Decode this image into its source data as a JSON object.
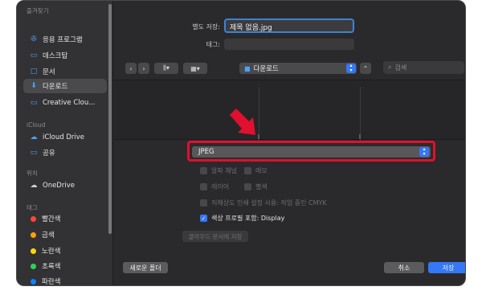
{
  "sidebar": {
    "favorites_header": "즐겨찾기",
    "favorites": [
      {
        "label": "응용 프로그램",
        "icon": "applications-icon"
      },
      {
        "label": "데스크탑",
        "icon": "desktop-icon"
      },
      {
        "label": "문서",
        "icon": "document-icon"
      },
      {
        "label": "다운로드",
        "icon": "download-icon",
        "active": true
      },
      {
        "label": "Creative Clou...",
        "icon": "folder-icon"
      }
    ],
    "icloud_header": "iCloud",
    "icloud": [
      {
        "label": "iCloud Drive",
        "icon": "cloud-icon"
      },
      {
        "label": "공유",
        "icon": "shared-folder-icon"
      }
    ],
    "locations_header": "위치",
    "locations": [
      {
        "label": "OneDrive",
        "icon": "cloud-icon"
      }
    ],
    "tags_header": "태그",
    "tags": [
      {
        "label": "빨간색",
        "color": "#ff453a"
      },
      {
        "label": "금색",
        "color": "#ff9f0a"
      },
      {
        "label": "노란색",
        "color": "#ffd60a"
      },
      {
        "label": "초록색",
        "color": "#30d158"
      },
      {
        "label": "파란색",
        "color": "#0a84ff"
      }
    ]
  },
  "form": {
    "save_as_label": "별도 저장:",
    "filename": "제목 없음.jpg",
    "tags_label": "태그:"
  },
  "toolbar": {
    "location": "다운로드",
    "search_placeholder": "검색"
  },
  "format": {
    "selected": "JPEG"
  },
  "options": {
    "alpha": "알파 채널",
    "memo": "메모",
    "layer": "레이어",
    "spot": "별색",
    "low_res": "저해상도 인쇄 설정 사용: 작업 중인 CMYK",
    "color_profile": "색상 프로필 포함: Display",
    "save_cloud": "클라우드 문서에 저장"
  },
  "buttons": {
    "new_folder": "새로운 폴더",
    "cancel": "취소",
    "save": "저장"
  },
  "colors": {
    "accent": "#3478f6",
    "highlight": "#e0102e"
  }
}
